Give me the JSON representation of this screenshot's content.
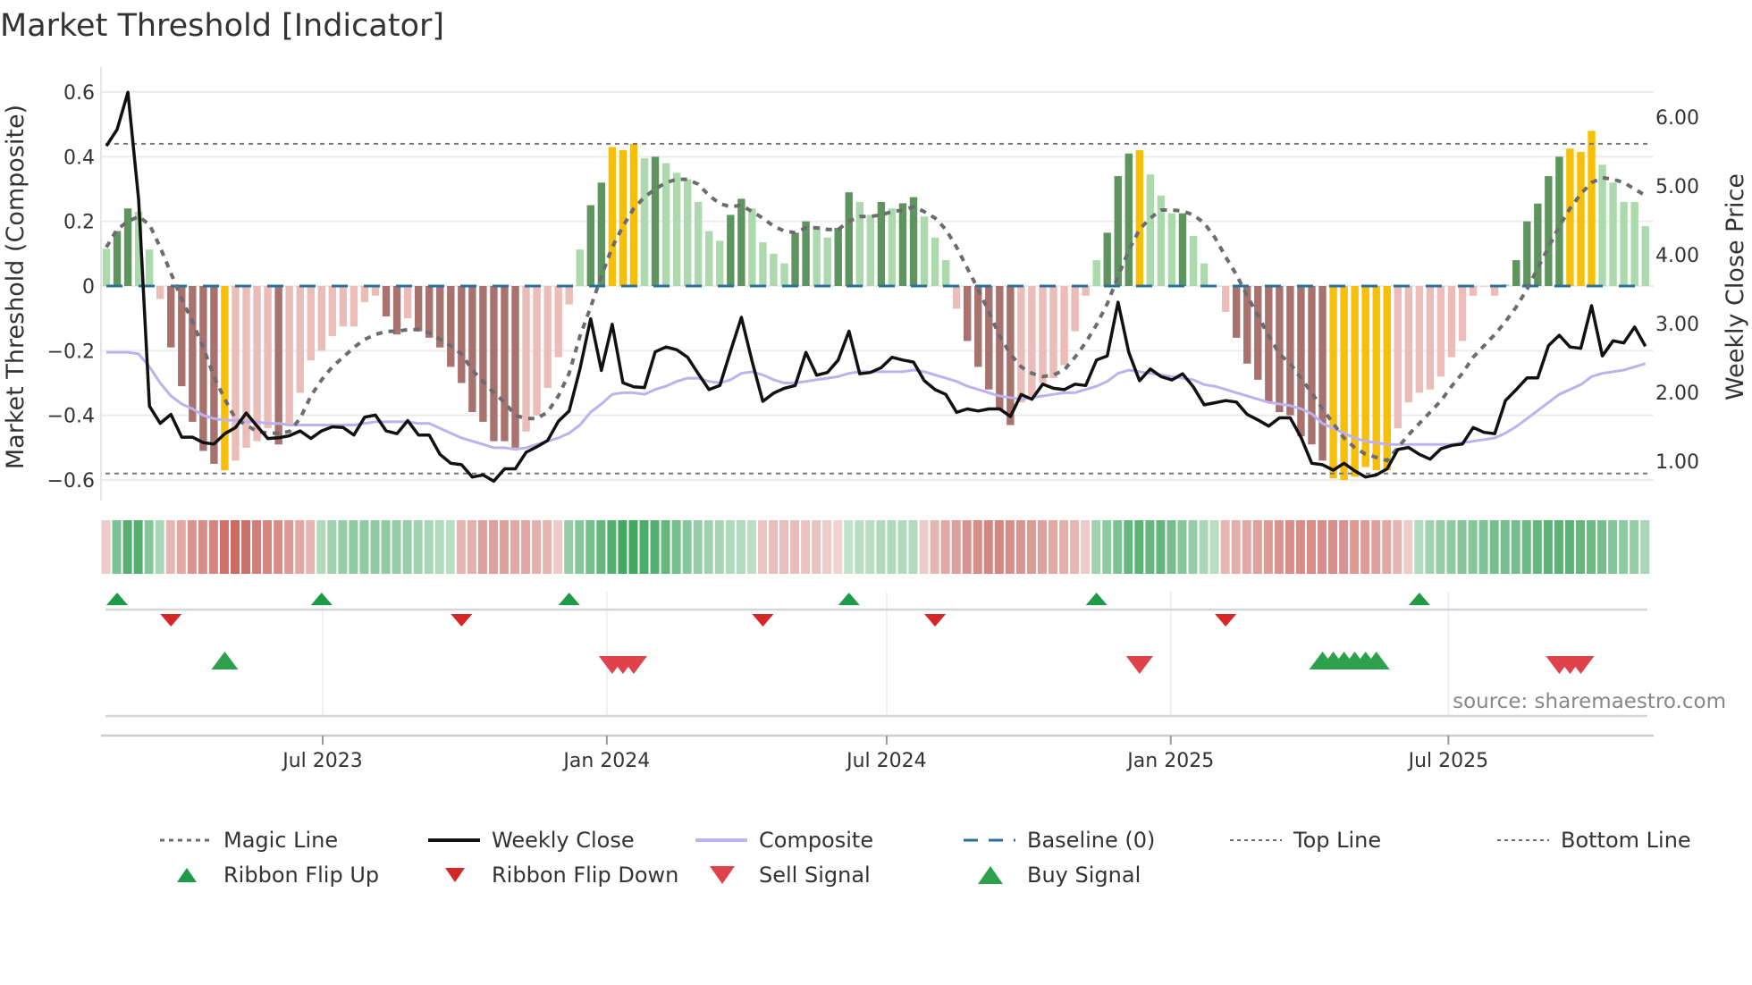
{
  "chart_data": {
    "type": "bar",
    "title": "Market Threshold [Indicator]",
    "ylabel_left": "Market Threshold (Composite)",
    "ylabel_right": "Weekly Close Price",
    "source": "source: sharemaestro.com",
    "ylim_left": [
      -0.66,
      0.66
    ],
    "ylim_right": [
      0.55,
      6.6
    ],
    "y_ticks_left": [
      {
        "v": 0.6,
        "label": "0.6"
      },
      {
        "v": 0.4,
        "label": "0.4"
      },
      {
        "v": 0.2,
        "label": "0.2"
      },
      {
        "v": 0,
        "label": "0"
      },
      {
        "v": -0.2,
        "label": "−0.2"
      },
      {
        "v": -0.4,
        "label": "−0.4"
      },
      {
        "v": -0.6,
        "label": "−0.6"
      }
    ],
    "y_ticks_right": [
      {
        "v": 6,
        "label": "6.00"
      },
      {
        "v": 5,
        "label": "5.00"
      },
      {
        "v": 4,
        "label": "4.00"
      },
      {
        "v": 3,
        "label": "3.00"
      },
      {
        "v": 2,
        "label": "2.00"
      },
      {
        "v": 1,
        "label": "1.00"
      }
    ],
    "x_ticks": [
      {
        "week": 20.1,
        "label": "Jul 2023"
      },
      {
        "week": 46.5,
        "label": "Jan 2024"
      },
      {
        "week": 72.5,
        "label": "Jul 2024"
      },
      {
        "week": 98.9,
        "label": "Jan 2025"
      },
      {
        "week": 124.7,
        "label": "Jul 2025"
      }
    ],
    "top_line": 0.44,
    "bottom_line": -0.58,
    "baseline": 0,
    "colors": {
      "dg": "#5e955e",
      "lg": "#acdaac",
      "dr": "#a8736f",
      "lr": "#ebbcb8",
      "au": "#f7bf07",
      "close": "#111111",
      "composite": "#bcb2ee",
      "magic": "#6b6b70",
      "baseline": "#2b6f9e",
      "ribbon_up": "#2f9e50",
      "ribbon_down": "#c4524a",
      "flip_up": "#1e9a48",
      "flip_down": "#d62728",
      "buy": "#2ca04c",
      "sell": "#e0424b"
    },
    "bar_values": [
      0.115,
      0.17,
      0.24,
      0.23,
      0.113,
      -0.04,
      -0.19,
      -0.31,
      -0.42,
      -0.51,
      -0.55,
      -0.57,
      -0.54,
      -0.5,
      -0.48,
      -0.44,
      -0.49,
      -0.43,
      -0.33,
      -0.23,
      -0.2,
      -0.155,
      -0.125,
      -0.125,
      -0.05,
      -0.03,
      -0.094,
      -0.15,
      -0.1,
      -0.14,
      -0.16,
      -0.19,
      -0.25,
      -0.3,
      -0.39,
      -0.42,
      -0.48,
      -0.48,
      -0.5,
      -0.45,
      -0.4,
      -0.315,
      -0.22,
      -0.057,
      0.113,
      0.25,
      0.32,
      0.43,
      0.42,
      0.44,
      0.395,
      0.4,
      0.38,
      0.35,
      0.33,
      0.26,
      0.17,
      0.14,
      0.22,
      0.27,
      0.24,
      0.135,
      0.1,
      0.07,
      0.165,
      0.2,
      0.185,
      0.15,
      0.18,
      0.29,
      0.26,
      0.22,
      0.26,
      0.24,
      0.256,
      0.275,
      0.215,
      0.15,
      0.08,
      -0.07,
      -0.17,
      -0.25,
      -0.32,
      -0.38,
      -0.43,
      -0.36,
      -0.34,
      -0.3,
      -0.285,
      -0.245,
      -0.14,
      -0.03,
      0.08,
      0.165,
      0.34,
      0.41,
      0.42,
      0.345,
      0.28,
      0.225,
      0.225,
      0.155,
      0.07,
      0,
      -0.08,
      -0.16,
      -0.24,
      -0.29,
      -0.36,
      -0.39,
      -0.4,
      -0.465,
      -0.49,
      -0.54,
      -0.595,
      -0.6,
      -0.59,
      -0.56,
      -0.57,
      -0.57,
      -0.44,
      -0.36,
      -0.33,
      -0.32,
      -0.28,
      -0.22,
      -0.17,
      -0.03,
      0,
      -0.03,
      0.005,
      0.08,
      0.2,
      0.255,
      0.34,
      0.4,
      0.425,
      0.415,
      0.48,
      0.375,
      0.32,
      0.26,
      0.26,
      0.185
    ],
    "bar_states": [
      "lg",
      "dg",
      "dg",
      "lg",
      "lg",
      "lr",
      "dr",
      "dr",
      "dr",
      "dr",
      "dr",
      "au",
      "lr",
      "lr",
      "lr",
      "lr",
      "dr",
      "lr",
      "lr",
      "lr",
      "lr",
      "lr",
      "lr",
      "lr",
      "lr",
      "lr",
      "dr",
      "dr",
      "lr",
      "dr",
      "dr",
      "dr",
      "dr",
      "dr",
      "dr",
      "dr",
      "dr",
      "dr",
      "dr",
      "lr",
      "lr",
      "lr",
      "lr",
      "lr",
      "lg",
      "dg",
      "dg",
      "au",
      "au",
      "au",
      "lg",
      "dg",
      "lg",
      "lg",
      "lg",
      "lg",
      "lg",
      "lg",
      "dg",
      "dg",
      "lg",
      "lg",
      "lg",
      "lg",
      "dg",
      "dg",
      "lg",
      "lg",
      "dg",
      "dg",
      "lg",
      "lg",
      "dg",
      "lg",
      "dg",
      "dg",
      "lg",
      "lg",
      "lg",
      "lr",
      "dr",
      "dr",
      "dr",
      "dr",
      "dr",
      "lr",
      "lr",
      "lr",
      "lr",
      "lr",
      "lr",
      "lr",
      "lg",
      "dg",
      "dg",
      "dg",
      "au",
      "lg",
      "lg",
      "lg",
      "dg",
      "lg",
      "lg",
      "lr",
      "lr",
      "dr",
      "dr",
      "dr",
      "dr",
      "dr",
      "dr",
      "dr",
      "dr",
      "dr",
      "au",
      "au",
      "au",
      "au",
      "au",
      "au",
      "lr",
      "lr",
      "lr",
      "lr",
      "lr",
      "lr",
      "lr",
      "lr",
      "lr",
      "lr",
      "lg",
      "dg",
      "dg",
      "dg",
      "dg",
      "dg",
      "au",
      "au",
      "au",
      "lg",
      "lg",
      "lg",
      "lg",
      "lg"
    ],
    "series": [
      {
        "name": "Magic Line",
        "axis": "left",
        "values": [
          0.12,
          0.175,
          0.2,
          0.215,
          0.19,
          0.12,
          0.04,
          -0.04,
          -0.11,
          -0.19,
          -0.28,
          -0.35,
          -0.41,
          -0.43,
          -0.45,
          -0.455,
          -0.455,
          -0.45,
          -0.41,
          -0.34,
          -0.29,
          -0.25,
          -0.22,
          -0.19,
          -0.165,
          -0.15,
          -0.14,
          -0.14,
          -0.135,
          -0.135,
          -0.145,
          -0.165,
          -0.185,
          -0.21,
          -0.26,
          -0.295,
          -0.33,
          -0.36,
          -0.4,
          -0.41,
          -0.41,
          -0.39,
          -0.34,
          -0.27,
          -0.155,
          -0.065,
          0.03,
          0.12,
          0.185,
          0.24,
          0.275,
          0.3,
          0.32,
          0.33,
          0.33,
          0.315,
          0.28,
          0.255,
          0.245,
          0.25,
          0.23,
          0.21,
          0.185,
          0.17,
          0.165,
          0.18,
          0.18,
          0.175,
          0.175,
          0.2,
          0.215,
          0.215,
          0.22,
          0.23,
          0.235,
          0.245,
          0.23,
          0.21,
          0.175,
          0.12,
          0.055,
          -0.01,
          -0.08,
          -0.155,
          -0.21,
          -0.25,
          -0.27,
          -0.28,
          -0.275,
          -0.26,
          -0.22,
          -0.175,
          -0.12,
          -0.055,
          0.03,
          0.11,
          0.175,
          0.21,
          0.235,
          0.235,
          0.232,
          0.22,
          0.195,
          0.15,
          0.09,
          0.035,
          -0.03,
          -0.09,
          -0.155,
          -0.21,
          -0.24,
          -0.285,
          -0.33,
          -0.38,
          -0.425,
          -0.47,
          -0.5,
          -0.52,
          -0.53,
          -0.54,
          -0.5,
          -0.46,
          -0.425,
          -0.39,
          -0.355,
          -0.31,
          -0.27,
          -0.22,
          -0.185,
          -0.15,
          -0.11,
          -0.065,
          -0.01,
          0.055,
          0.12,
          0.185,
          0.24,
          0.285,
          0.32,
          0.335,
          0.33,
          0.32,
          0.3,
          0.28
        ]
      },
      {
        "name": "Weekly Close",
        "axis": "right",
        "values": [
          5.58,
          5.82,
          6.36,
          4.8,
          1.8,
          1.55,
          1.68,
          1.35,
          1.35,
          1.27,
          1.25,
          1.4,
          1.49,
          1.7,
          1.51,
          1.33,
          1.34,
          1.37,
          1.44,
          1.33,
          1.44,
          1.5,
          1.49,
          1.38,
          1.64,
          1.67,
          1.44,
          1.4,
          1.59,
          1.38,
          1.38,
          1.1,
          0.97,
          0.95,
          0.77,
          0.8,
          0.71,
          0.89,
          0.89,
          1.13,
          1.21,
          1.3,
          1.58,
          1.73,
          2.34,
          3.07,
          2.32,
          2.99,
          2.14,
          2.08,
          2.07,
          2.59,
          2.66,
          2.62,
          2.51,
          2.27,
          2.04,
          2.1,
          2.6,
          3.09,
          2.45,
          1.87,
          1.99,
          2.06,
          2.1,
          2.58,
          2.25,
          2.29,
          2.47,
          2.89,
          2.27,
          2.29,
          2.36,
          2.51,
          2.47,
          2.44,
          2.17,
          2.04,
          1.97,
          1.71,
          1.76,
          1.73,
          1.76,
          1.76,
          1.65,
          1.97,
          1.9,
          2.12,
          2.06,
          2.04,
          2.12,
          2.1,
          2.47,
          2.53,
          3.31,
          2.58,
          2.17,
          2.34,
          2.23,
          2.18,
          2.27,
          2.08,
          1.82,
          1.85,
          1.88,
          1.86,
          1.68,
          1.6,
          1.51,
          1.63,
          1.63,
          1.35,
          0.97,
          0.95,
          0.87,
          0.97,
          0.86,
          0.77,
          0.8,
          0.89,
          1.17,
          1.2,
          1.1,
          1.03,
          1.18,
          1.23,
          1.25,
          1.49,
          1.42,
          1.4,
          1.88,
          2.04,
          2.21,
          2.21,
          2.68,
          2.83,
          2.66,
          2.64,
          3.26,
          2.53,
          2.75,
          2.72,
          2.95,
          2.67
        ]
      },
      {
        "name": "Composite",
        "axis": "left",
        "values": [
          -0.205,
          -0.205,
          -0.205,
          -0.21,
          -0.25,
          -0.3,
          -0.34,
          -0.365,
          -0.38,
          -0.4,
          -0.41,
          -0.415,
          -0.415,
          -0.42,
          -0.42,
          -0.425,
          -0.425,
          -0.43,
          -0.43,
          -0.43,
          -0.43,
          -0.43,
          -0.43,
          -0.43,
          -0.425,
          -0.42,
          -0.42,
          -0.42,
          -0.42,
          -0.425,
          -0.425,
          -0.44,
          -0.455,
          -0.47,
          -0.48,
          -0.49,
          -0.5,
          -0.5,
          -0.505,
          -0.5,
          -0.49,
          -0.48,
          -0.47,
          -0.455,
          -0.43,
          -0.39,
          -0.365,
          -0.335,
          -0.33,
          -0.33,
          -0.335,
          -0.32,
          -0.31,
          -0.295,
          -0.285,
          -0.285,
          -0.295,
          -0.3,
          -0.29,
          -0.27,
          -0.265,
          -0.275,
          -0.29,
          -0.3,
          -0.3,
          -0.295,
          -0.29,
          -0.285,
          -0.28,
          -0.27,
          -0.265,
          -0.265,
          -0.265,
          -0.265,
          -0.265,
          -0.26,
          -0.265,
          -0.275,
          -0.285,
          -0.295,
          -0.31,
          -0.32,
          -0.33,
          -0.34,
          -0.345,
          -0.35,
          -0.345,
          -0.34,
          -0.335,
          -0.33,
          -0.33,
          -0.32,
          -0.31,
          -0.295,
          -0.27,
          -0.26,
          -0.265,
          -0.27,
          -0.275,
          -0.28,
          -0.285,
          -0.29,
          -0.305,
          -0.31,
          -0.32,
          -0.33,
          -0.34,
          -0.35,
          -0.36,
          -0.365,
          -0.37,
          -0.38,
          -0.395,
          -0.425,
          -0.44,
          -0.455,
          -0.47,
          -0.48,
          -0.485,
          -0.49,
          -0.49,
          -0.49,
          -0.49,
          -0.49,
          -0.49,
          -0.49,
          -0.485,
          -0.48,
          -0.475,
          -0.47,
          -0.455,
          -0.435,
          -0.41,
          -0.385,
          -0.36,
          -0.335,
          -0.32,
          -0.305,
          -0.28,
          -0.27,
          -0.265,
          -0.26,
          -0.25,
          -0.24
        ]
      }
    ],
    "ribbon": [
      -0.15,
      0.55,
      0.8,
      0.8,
      0.5,
      0.3,
      -0.3,
      -0.4,
      -0.55,
      -0.6,
      -0.65,
      -0.8,
      -0.85,
      -0.8,
      -0.7,
      -0.65,
      -0.6,
      -0.5,
      -0.4,
      -0.3,
      0.25,
      0.35,
      0.4,
      0.45,
      0.45,
      0.45,
      0.45,
      0.4,
      0.4,
      0.35,
      0.3,
      0.25,
      0.2,
      -0.3,
      -0.35,
      -0.45,
      -0.45,
      -0.45,
      -0.4,
      -0.4,
      -0.35,
      -0.3,
      -0.15,
      0.4,
      0.5,
      0.6,
      0.7,
      0.8,
      0.9,
      0.9,
      0.85,
      0.8,
      0.7,
      0.6,
      0.5,
      0.4,
      0.35,
      0.3,
      0.25,
      0.25,
      0.2,
      -0.2,
      -0.25,
      -0.25,
      -0.25,
      -0.2,
      -0.2,
      -0.15,
      -0.1,
      0.15,
      0.2,
      0.2,
      0.25,
      0.25,
      0.25,
      0.25,
      -0.15,
      -0.3,
      -0.4,
      -0.45,
      -0.55,
      -0.6,
      -0.65,
      -0.65,
      -0.6,
      -0.55,
      -0.5,
      -0.45,
      -0.4,
      -0.35,
      -0.3,
      -0.15,
      0.35,
      0.45,
      0.55,
      0.7,
      0.75,
      0.7,
      0.7,
      0.6,
      0.5,
      0.4,
      0.3,
      0.2,
      -0.3,
      -0.35,
      -0.4,
      -0.45,
      -0.5,
      -0.55,
      -0.6,
      -0.6,
      -0.6,
      -0.6,
      -0.6,
      -0.55,
      -0.5,
      -0.5,
      -0.45,
      -0.4,
      -0.3,
      -0.15,
      0.25,
      0.35,
      0.4,
      0.45,
      0.5,
      0.5,
      0.55,
      0.6,
      0.6,
      0.6,
      0.65,
      0.7,
      0.75,
      0.75,
      0.75,
      0.7,
      0.65,
      0.6,
      0.5,
      0.45,
      0.4,
      0.3
    ],
    "ribbon_flip_up_weeks": [
      1,
      20,
      43,
      69,
      92,
      122
    ],
    "ribbon_flip_down_weeks": [
      6,
      33,
      61,
      77,
      104
    ],
    "buy_signal_weeks": [
      11,
      113,
      114,
      115,
      116,
      117,
      118
    ],
    "sell_signal_weeks": [
      47,
      48,
      49,
      96,
      135,
      136,
      137
    ],
    "legend": [
      {
        "label": "Magic Line",
        "kind": "dotted",
        "color_key": "magic"
      },
      {
        "label": "Weekly Close",
        "kind": "solid",
        "color_key": "close"
      },
      {
        "label": "Composite",
        "kind": "solid",
        "color_key": "composite"
      },
      {
        "label": "Baseline (0)",
        "kind": "dashed",
        "color_key": "baseline"
      },
      {
        "label": "Top Line",
        "kind": "fine-dotted",
        "color_key": "magic"
      },
      {
        "label": "Bottom Line",
        "kind": "fine-dotted",
        "color_key": "magic"
      },
      {
        "label": "Ribbon Flip Up",
        "kind": "tri-up-small",
        "color_key": "flip_up"
      },
      {
        "label": "Ribbon Flip Down",
        "kind": "tri-down-small",
        "color_key": "flip_down"
      },
      {
        "label": "Sell Signal",
        "kind": "tri-down",
        "color_key": "sell"
      },
      {
        "label": "Buy Signal",
        "kind": "tri-up",
        "color_key": "buy"
      }
    ]
  }
}
